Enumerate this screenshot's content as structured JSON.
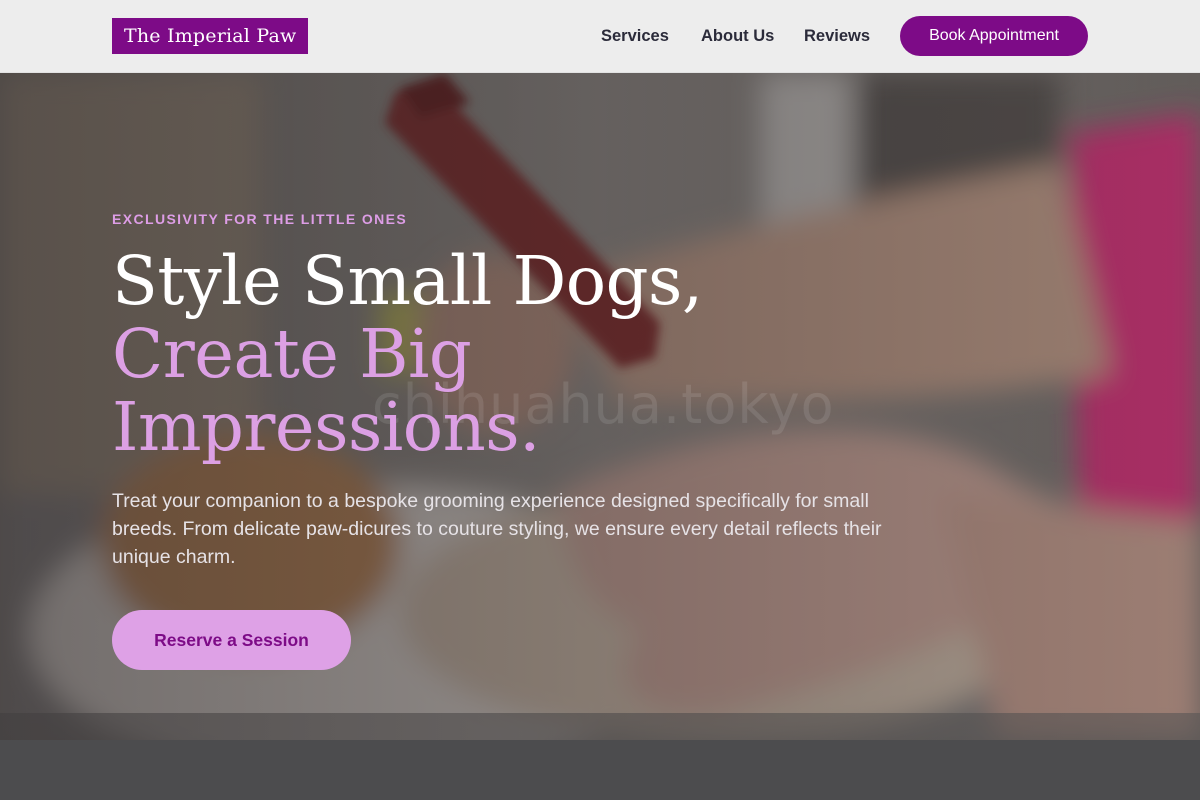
{
  "brand": {
    "name": "The Imperial Paw",
    "color": "#7d0b87",
    "accent_light": "#dca0e4"
  },
  "nav": {
    "links": [
      "Services",
      "About Us",
      "Reviews"
    ],
    "cta_label": "Book Appointment"
  },
  "hero": {
    "eyebrow": "EXCLUSIVITY FOR THE LITTLE ONES",
    "headline_line1": "Style Small Dogs,",
    "headline_line2": "Create Big",
    "headline_line3": "Impressions.",
    "body": "Treat your companion to a bespoke grooming experience designed specifically for small breeds. From delicate paw-dicures to couture styling, we ensure every detail reflects their unique charm.",
    "cta_label": "Reserve a Session",
    "background_image": "groomer-trimming-small-dog-photo",
    "watermark": "chihuahua.tokyo"
  }
}
